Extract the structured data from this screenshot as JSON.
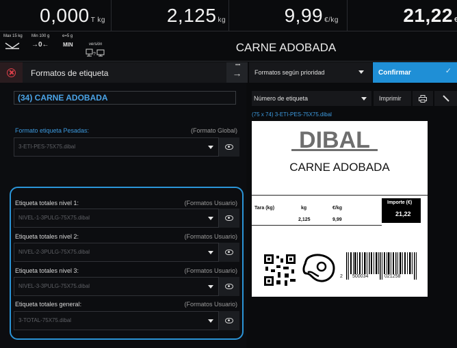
{
  "top": {
    "tara": {
      "value": "0,000",
      "unit": "T kg"
    },
    "weight": {
      "value": "2,125",
      "unit": "kg"
    },
    "price": {
      "value": "9,99",
      "unit": "€/kg"
    },
    "total": {
      "value": "21,22",
      "unit": "€"
    }
  },
  "status": {
    "max": "Max 15 kg",
    "min": "Min 100 g",
    "e": "e=5 g",
    "zero": "→0←",
    "min_label": "MIN",
    "version": "versión",
    "product": "CARNE ADOBADA"
  },
  "toolbar": {
    "title": "Formatos de etiqueta",
    "priority": "Formatos según prioridad",
    "confirm": "Confirmar"
  },
  "left": {
    "product_name": "(34)  CARNE ADOBADA",
    "pesadas": {
      "label": "Formato etiqueta Pesadas:",
      "hint": "(Formato Global)",
      "value": "3-ETI-PES-75X75.dibal"
    },
    "nivel1": {
      "label": "Etiqueta totales nivel 1:",
      "hint": "(Formatos Usuario)",
      "value": "NIVEL-1-3PULG-75X75.dibal"
    },
    "nivel2": {
      "label": "Etiqueta totales nivel 2:",
      "hint": "(Formatos Usuario)",
      "value": "NIVEL-2-3PULG-75X75.dibal"
    },
    "nivel3": {
      "label": "Etiqueta totales nivel 3:",
      "hint": "(Formatos Usuario)",
      "value": "NIVEL-3-3PULG-75X75.dibal"
    },
    "general": {
      "label": "Etiqueta totales general:",
      "hint": "(Formatos Usuario)",
      "value": "3-TOTAL-75X75.dibal"
    }
  },
  "right": {
    "label_number": "Número de etiqueta",
    "print": "Imprimir",
    "format_id": "(75 x 74)  3-ETI-PES-75X75.dibal",
    "preview": {
      "logo": "DIBAL",
      "product": "CARNE ADOBADA",
      "tara_h": "Tara (kg)",
      "kg_h": "kg",
      "eurokg_h": "€/kg",
      "importe_h": "Importe (€)",
      "kg_v": "2,125",
      "eurokg_v": "9,99",
      "importe_v": "21,22",
      "barcode_prefix": "2",
      "barcode_mid": "500034",
      "barcode_end": "021258"
    }
  },
  "colors": {
    "accent": "#1f8fd6",
    "close": "#e0404a",
    "name": "#4aa3e6"
  }
}
